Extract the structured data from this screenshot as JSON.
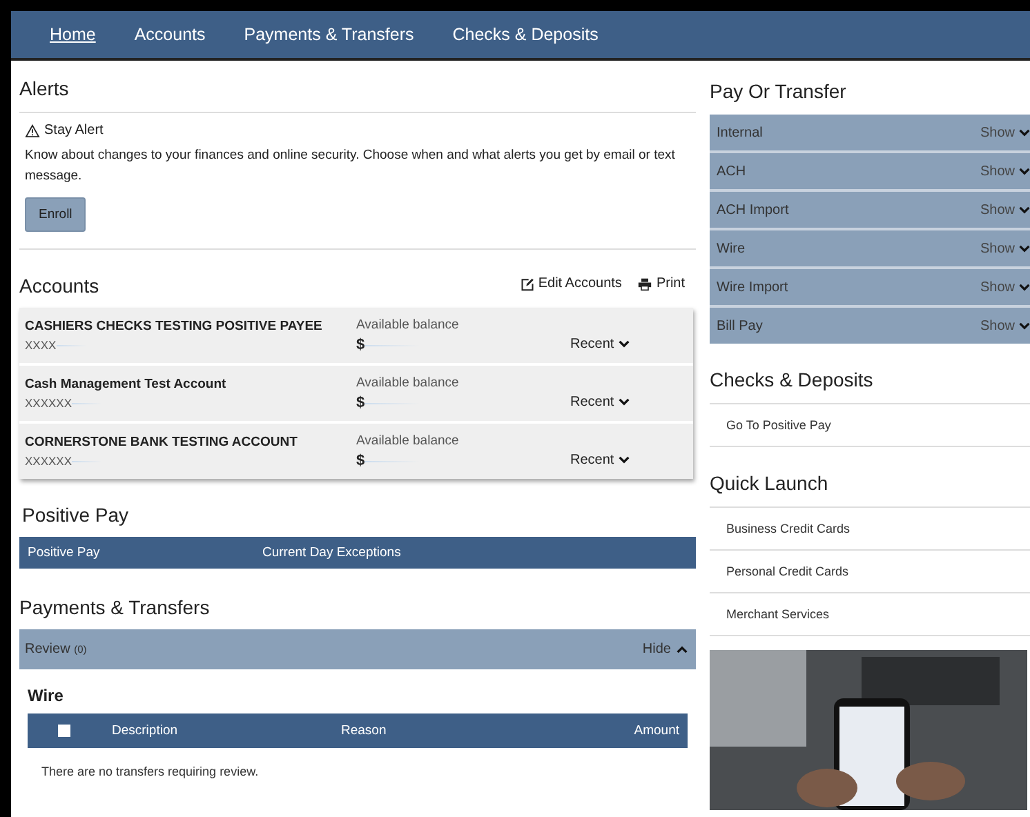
{
  "nav": [
    {
      "label": "Home",
      "selected": true
    },
    {
      "label": "Accounts",
      "selected": false
    },
    {
      "label": "Payments & Transfers",
      "selected": false
    },
    {
      "label": "Checks & Deposits",
      "selected": false
    }
  ],
  "alerts": {
    "title": "Alerts",
    "alert_title": "Stay Alert",
    "message": "Know about changes to your finances and online security. Choose when and what alerts you get by email or text message.",
    "button": "Enroll"
  },
  "accounts": {
    "title": "Accounts",
    "actions": [
      {
        "label": "Edit Accounts",
        "kind": "edit"
      },
      {
        "label": "Print",
        "kind": "print"
      }
    ],
    "rows": [
      {
        "name": "CASHIERS CHECKS TESTING POSITIVE PAYEE",
        "number": "XXXX",
        "balance_label": "Available balance",
        "balance": "$",
        "toggle": "Recent"
      },
      {
        "name": "Cash Management Test Account",
        "number": "XXXXXX",
        "balance_label": "Available balance",
        "balance": "$",
        "toggle": "Recent"
      },
      {
        "name": "CORNERSTONE BANK TESTING ACCOUNT",
        "number": "XXXXXX",
        "balance_label": "Available balance",
        "balance": "$",
        "toggle": "Recent"
      }
    ]
  },
  "positive_pay": {
    "title": "Positive Pay",
    "columns": [
      "Positive Pay",
      "Current Day Exceptions"
    ]
  },
  "payments": {
    "title": "Payments & Transfers",
    "review": {
      "label": "Review",
      "count": "(0)",
      "toggle": "Hide",
      "expanded": true
    },
    "section": "Wire",
    "columns": [
      "Description",
      "Reason",
      "Amount"
    ],
    "select_all_checked": false,
    "empty": "There are no transfers requiring review."
  },
  "pay_or_transfer": {
    "title": "Pay Or Transfer",
    "items": [
      {
        "label": "Internal",
        "toggle": "Show",
        "expanded": false
      },
      {
        "label": "ACH",
        "toggle": "Show",
        "expanded": false
      },
      {
        "label": "ACH Import",
        "toggle": "Show",
        "expanded": false
      },
      {
        "label": "Wire",
        "toggle": "Show",
        "expanded": false
      },
      {
        "label": "Wire Import",
        "toggle": "Show",
        "expanded": false
      },
      {
        "label": "Bill Pay",
        "toggle": "Show",
        "expanded": false
      }
    ]
  },
  "checks_deposits": {
    "title": "Checks & Deposits",
    "links": [
      "Go To Positive Pay"
    ]
  },
  "quick_launch": {
    "title": "Quick Launch",
    "links": [
      "Business Credit Cards",
      "Personal Credit Cards",
      "Merchant Services"
    ]
  }
}
